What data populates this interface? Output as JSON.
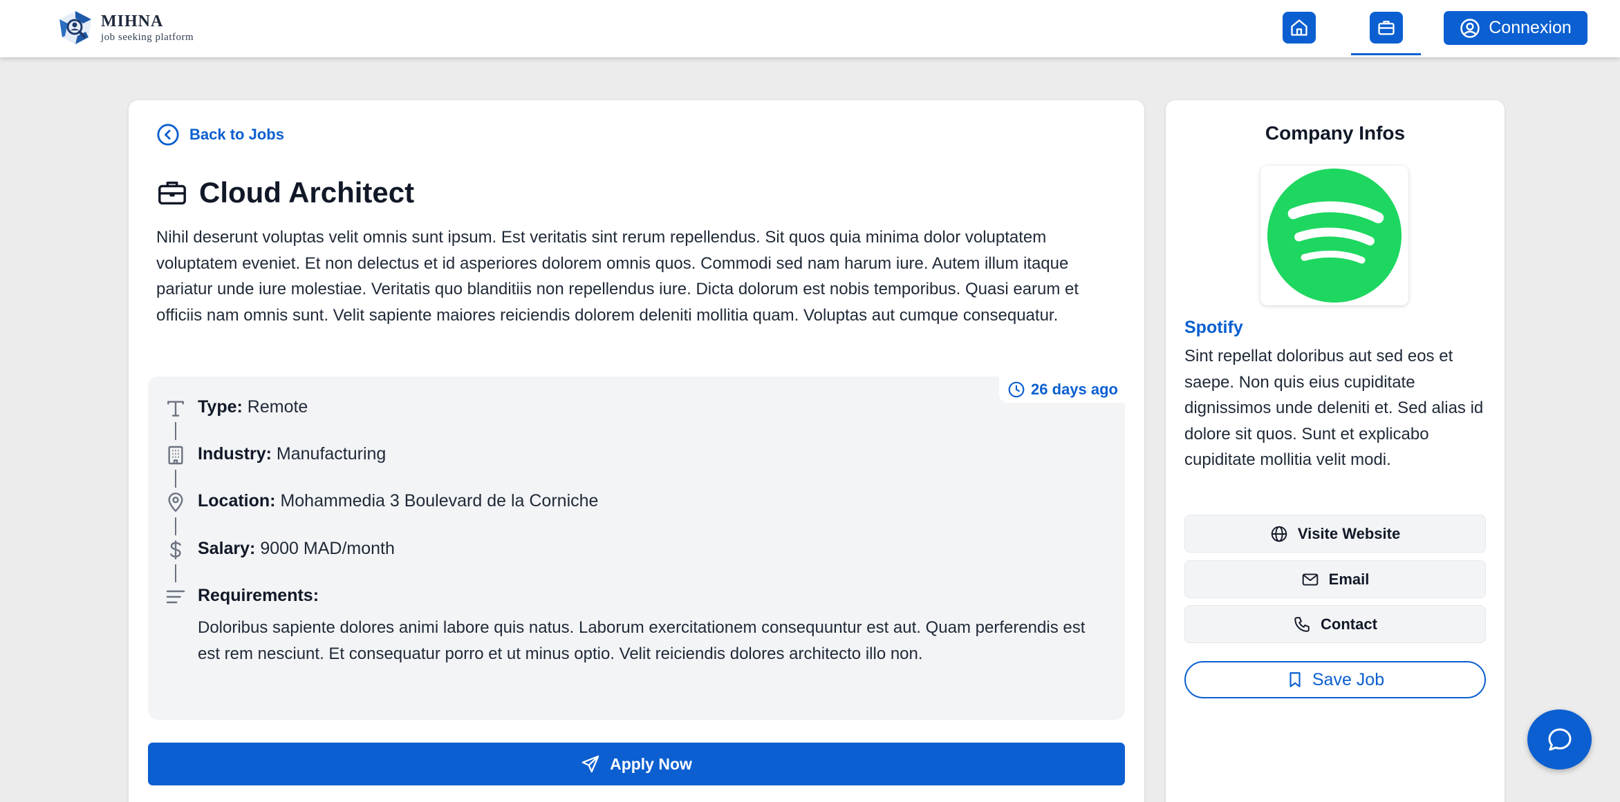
{
  "header": {
    "brand_name": "MIHNA",
    "brand_tagline": "job seeking platform",
    "login_label": "Connexion"
  },
  "job": {
    "back_label": "Back to Jobs",
    "title": "Cloud Architect",
    "description": "Nihil deserunt voluptas velit omnis sunt ipsum. Est veritatis sint rerum repellendus. Sit quos quia minima dolor voluptatem voluptatem eveniet. Et non delectus et id asperiores dolorem omnis quos. Commodi sed nam harum iure. Autem illum itaque pariatur unde iure molestiae. Veritatis quo blanditiis non repellendus iure. Dicta dolorum est nobis temporibus. Quasi earum et officiis nam omnis sunt. Velit sapiente maiores reiciendis dolorem deleniti mollitia quam. Voluptas aut cumque consequatur.",
    "posted": "26 days ago",
    "details": {
      "type_label": "Type:",
      "type_value": "Remote",
      "industry_label": "Industry:",
      "industry_value": "Manufacturing",
      "location_label": "Location:",
      "location_value": "Mohammedia 3 Boulevard de la Corniche",
      "salary_label": "Salary:",
      "salary_value": "9000 MAD/month",
      "requirements_label": "Requirements:",
      "requirements_value": "Doloribus sapiente dolores animi labore quis natus. Laborum exercitationem consequuntur est aut. Quam perferendis est est rem nesciunt. Et consequatur porro et ut minus optio. Velit reiciendis dolores architecto illo non."
    },
    "apply_label": "Apply Now"
  },
  "company": {
    "heading": "Company Infos",
    "name": "Spotify",
    "description": "Sint repellat doloribus aut sed eos et saepe. Non quis eius cupiditate dignissimos unde deleniti et. Sed alias id dolore sit quos. Sunt et explicabo cupiditate mollitia velit modi.",
    "website_label": "Visite Website",
    "email_label": "Email",
    "contact_label": "Contact",
    "save_label": "Save Job"
  },
  "icons": {
    "home": "home-icon",
    "jobs": "briefcase-icon",
    "user": "user-circle-icon",
    "chat": "chat-bubble-icon"
  },
  "colors": {
    "primary": "#0b5fd0",
    "background": "#ececec",
    "panel": "#f3f4f6",
    "spotify_green": "#1ed760"
  }
}
